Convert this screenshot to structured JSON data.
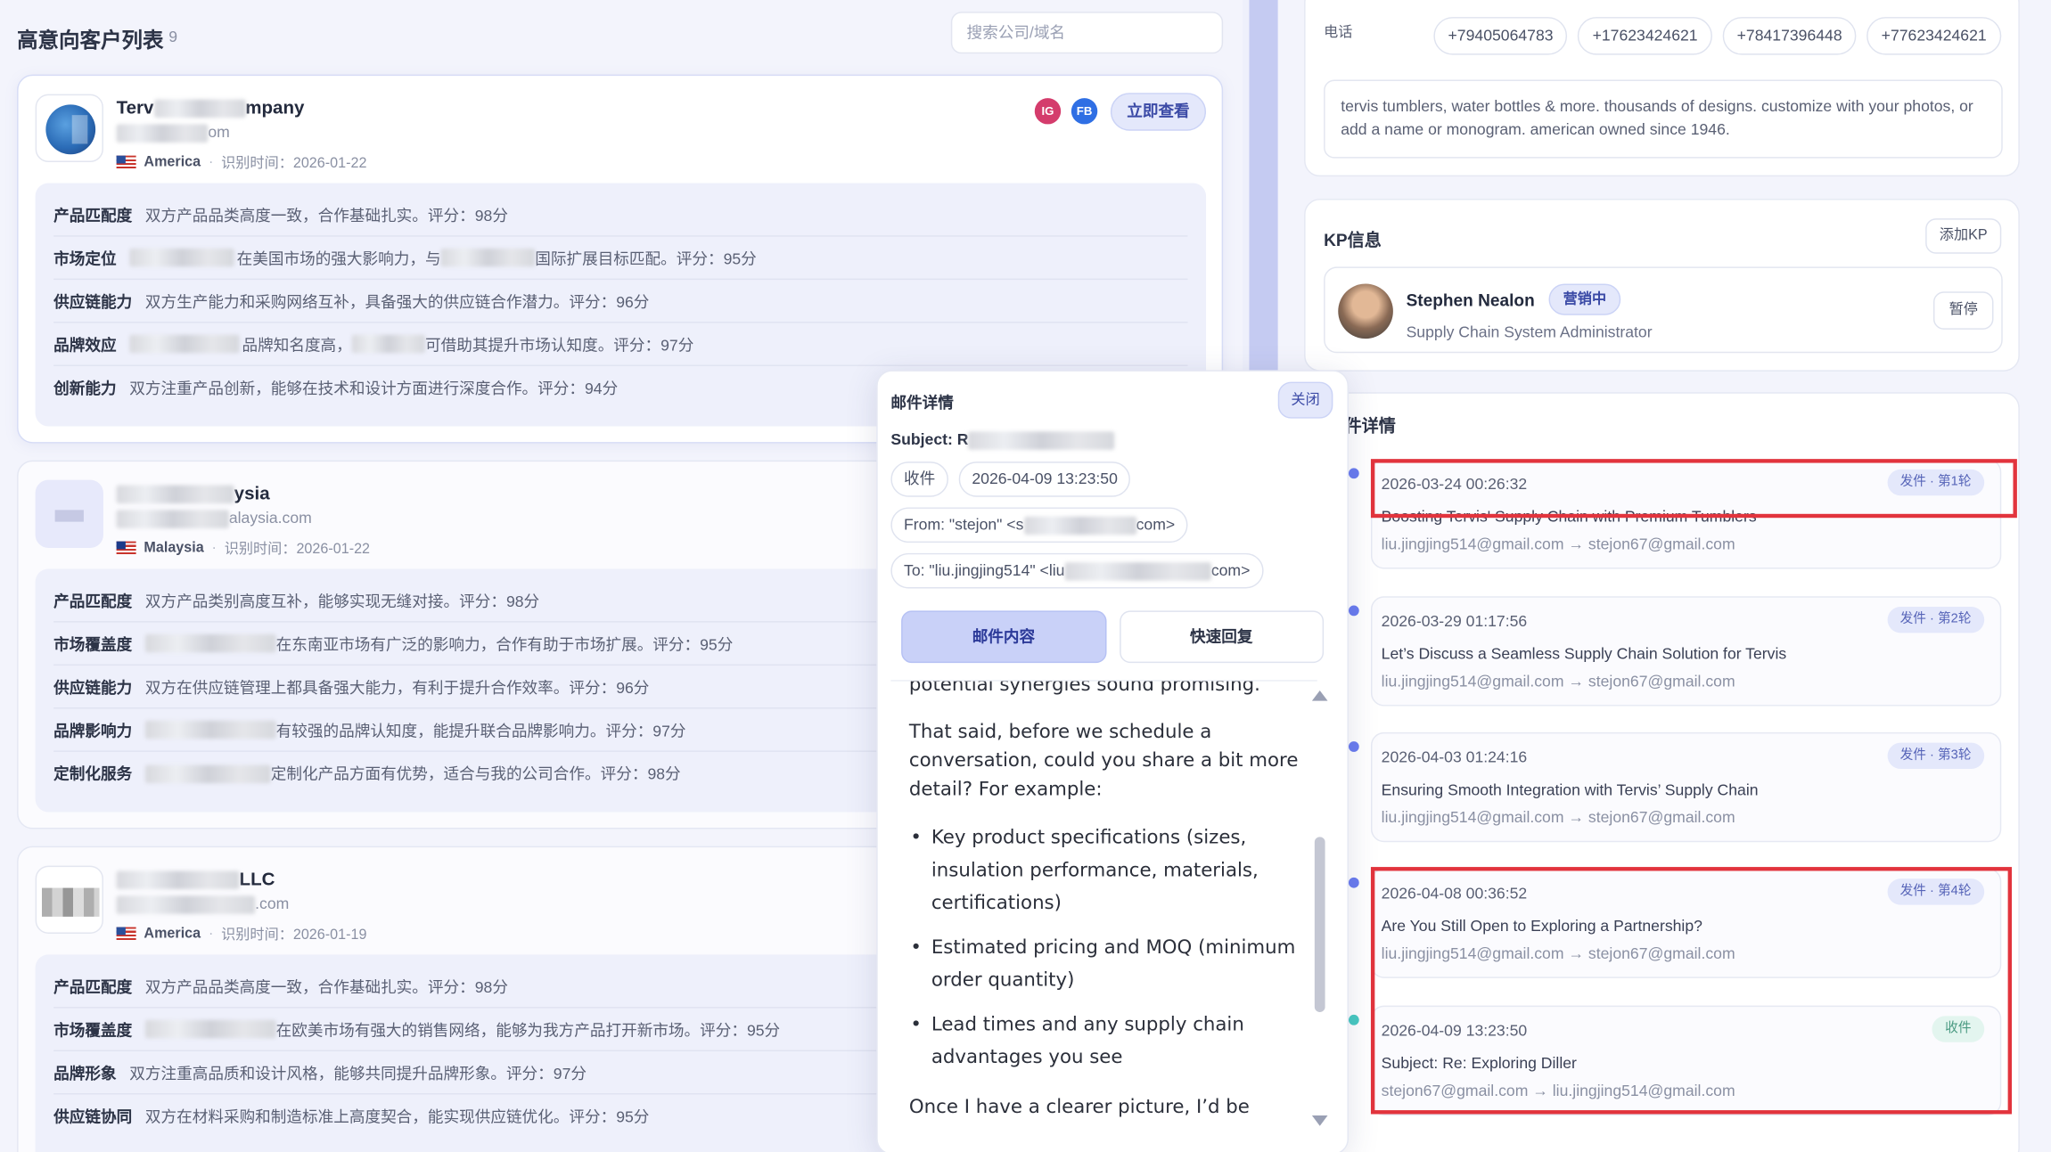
{
  "list": {
    "title": "高意向客户列表",
    "count": "9",
    "search_placeholder": "搜索公司/域名"
  },
  "cards": [
    {
      "name_prefix": "Terv",
      "name_suffix": "mpany",
      "domain_suffix": "om",
      "country": "America",
      "identified": "识别时间：2026-01-22",
      "badge_ig": "IG",
      "badge_fb": "FB",
      "view_label": "立即查看",
      "rows": [
        {
          "k": "产品匹配度",
          "v": "双方产品品类高度一致，合作基础扎实。评分：98分"
        },
        {
          "k": "市场定位",
          "v_pre": "",
          "v": "在美国市场的强大影响力，与",
          "v2": "国际扩展目标匹配。评分：95分"
        },
        {
          "k": "供应链能力",
          "v": "双方生产能力和采购网络互补，具备强大的供应链合作潜力。评分：96分"
        },
        {
          "k": "品牌效应",
          "v": "品牌知名度高，",
          "v2": "可借助其提升市场认知度。评分：97分"
        },
        {
          "k": "创新能力",
          "v": "双方注重产品创新，能够在技术和设计方面进行深度合作。评分：94分"
        }
      ]
    },
    {
      "name_suffix": "ysia",
      "domain_suffix": "alaysia.com",
      "country": "Malaysia",
      "identified": "识别时间：2026-01-22",
      "rows": [
        {
          "k": "产品匹配度",
          "v": "双方产品类别高度互补，能够实现无缝对接。评分：98分"
        },
        {
          "k": "市场覆盖度",
          "v": "在东南亚市场有广泛的影响力，合作有助于市场扩展。评分：95分"
        },
        {
          "k": "供应链能力",
          "v": "双方在供应链管理上都具备强大能力，有利于提升合作效率。评分：96分"
        },
        {
          "k": "品牌影响力",
          "v": "有较强的品牌认知度，能提升联合品牌影响力。评分：97分"
        },
        {
          "k": "定制化服务",
          "v": "定制化产品方面有优势，适合与我的公司合作。评分：98分"
        }
      ]
    },
    {
      "name_suffix": "LLC",
      "domain_suffix": ".com",
      "country": "America",
      "identified": "识别时间：2026-01-19",
      "rows": [
        {
          "k": "产品匹配度",
          "v": "双方产品品类高度一致，合作基础扎实。评分：98分"
        },
        {
          "k": "市场覆盖度",
          "v": "在欧美市场有强大的销售网络，能够为我方产品打开新市场。评分：95分"
        },
        {
          "k": "品牌形象",
          "v": "双方注重高品质和设计风格，能够共同提升品牌形象。评分：97分"
        },
        {
          "k": "供应链协同",
          "v": "双方在材料采购和制造标准上高度契合，能实现供应链优化。评分：95分"
        }
      ]
    }
  ],
  "phone": {
    "label": "电话",
    "numbers": [
      "+79405064783",
      "+17623424621",
      "+78417396448",
      "+77623424621"
    ],
    "description": "tervis tumblers, water bottles & more. thousands of designs. customize with your photos, or add a name or monogram. american owned since 1946."
  },
  "kp": {
    "title": "KP信息",
    "add_label": "添加KP",
    "name": "Stephen Nealon",
    "tag": "营销中",
    "role": "Supply Chain System Administrator",
    "pause_label": "暂停"
  },
  "mail_section": {
    "title": "件详情",
    "emails": [
      {
        "time": "2026-03-24 00:26:32",
        "tag": "发件 · 第1轮",
        "subject": "Boosting Tervis' Supply Chain with Premium Tumblers",
        "addr": "liu.jingjing514@gmail.com → stejon67@gmail.com"
      },
      {
        "time": "2026-03-29 01:17:56",
        "tag": "发件 · 第2轮",
        "subject": "Let’s Discuss a Seamless Supply Chain Solution for Tervis",
        "addr": "liu.jingjing514@gmail.com → stejon67@gmail.com"
      },
      {
        "time": "2026-04-03 01:24:16",
        "tag": "发件 · 第3轮",
        "subject": "Ensuring Smooth Integration with Tervis’ Supply Chain",
        "addr": "liu.jingjing514@gmail.com → stejon67@gmail.com"
      },
      {
        "time": "2026-04-08 00:36:52",
        "tag": "发件 · 第4轮",
        "subject": "Are You Still Open to Exploring a Partnership?",
        "addr": "liu.jingjing514@gmail.com → stejon67@gmail.com"
      },
      {
        "time": "2026-04-09 13:23:50",
        "tag": "收件",
        "subject": "Subject: Re: Exploring Diller",
        "addr": "stejon67@gmail.com → liu.jingjing514@gmail.com"
      }
    ]
  },
  "modal": {
    "title": "邮件详情",
    "close_label": "关闭",
    "subject_label": "Subject: R",
    "direction": "收件",
    "time": "2026-04-09 13:23:50",
    "from_prefix": "From: \"stejon\" <s",
    "from_suffix": "com>",
    "to_prefix": "To: \"liu.jingjing514\" <liu",
    "to_suffix": "com>",
    "tab_content": "邮件内容",
    "tab_reply": "快速回复",
    "body_line0": "potential synergies sound promising.",
    "body_p1": "That said, before we schedule a conversation, could you share a bit more detail? For example:",
    "bullets": [
      "Key product specifications (sizes, insulation performance, materials, certifications)",
      "Estimated pricing and MOQ (minimum order quantity)",
      "Lead times and any supply chain advantages you see"
    ],
    "body_p2": "Once I have a clearer picture, I’d be"
  }
}
